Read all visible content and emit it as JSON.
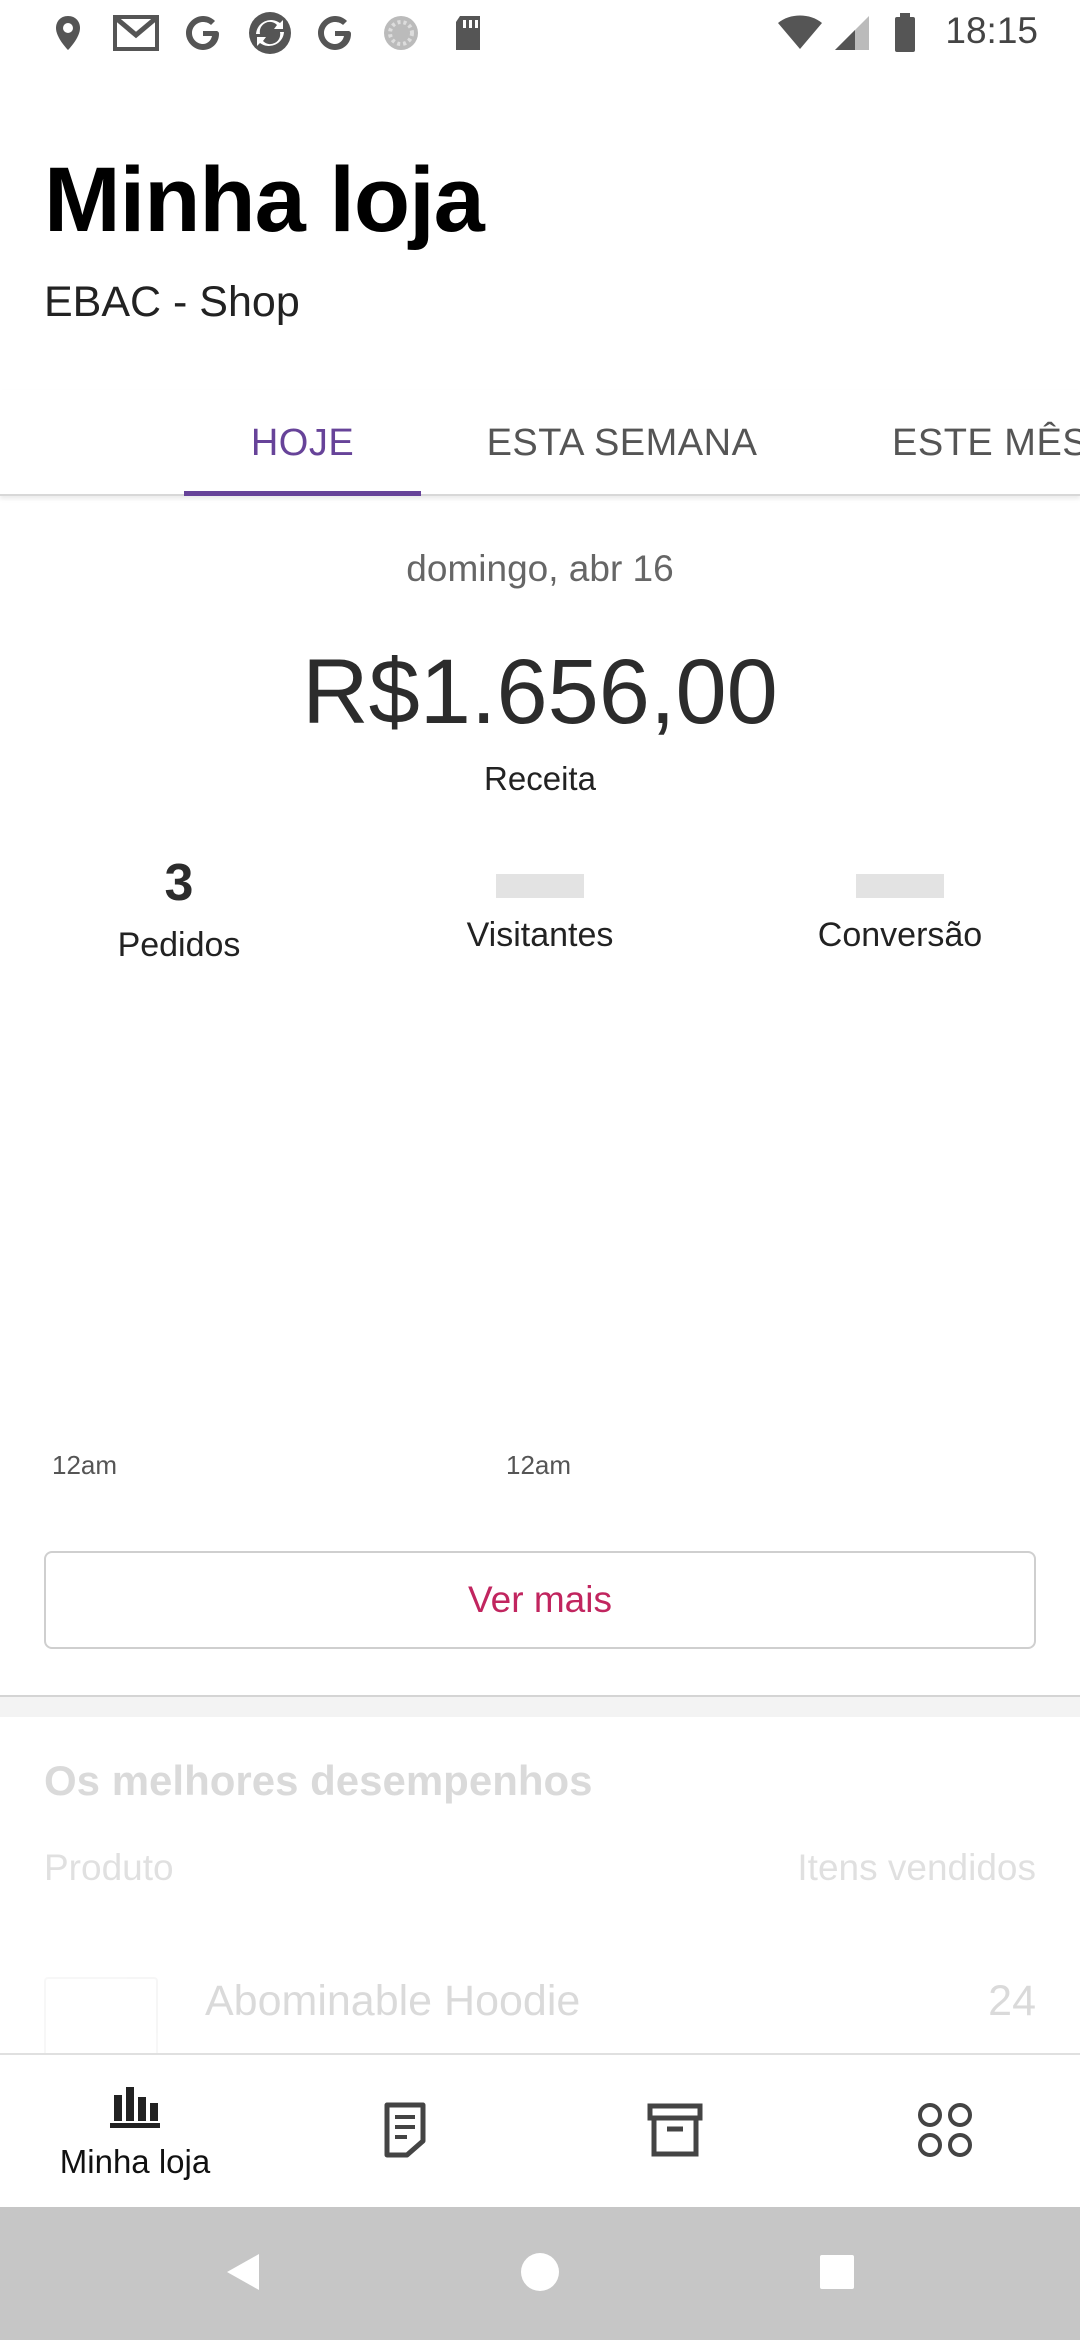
{
  "status_bar": {
    "time": "18:15",
    "left_icons": [
      "location-icon",
      "gmail-icon",
      "google-icon",
      "sync-app-icon",
      "google-icon",
      "loading-icon",
      "sd-card-icon"
    ],
    "right_icons": [
      "wifi-icon",
      "signal-icon",
      "battery-icon"
    ]
  },
  "header": {
    "title": "Minha loja",
    "store_name": "EBAC - Shop"
  },
  "tabs": [
    {
      "label": "HOJE",
      "active": true
    },
    {
      "label": "ESTA SEMANA",
      "active": false
    },
    {
      "label": "ESTE MÊS",
      "active": false
    }
  ],
  "stats": {
    "date": "domingo, abr 16",
    "revenue": "R$1.656,00",
    "revenue_label": "Receita",
    "metrics": [
      {
        "label": "Pedidos",
        "value": "3"
      },
      {
        "label": "Visitantes",
        "value": ""
      },
      {
        "label": "Conversão",
        "value": ""
      }
    ],
    "chart_labels": [
      "12am",
      "12am"
    ],
    "more_button": "Ver mais"
  },
  "top_performers": {
    "title": "Os melhores desempenhos",
    "col_product": "Produto",
    "col_items": "Itens vendidos",
    "rows": [
      {
        "name": "Abominable Hoodie",
        "count": "24"
      }
    ]
  },
  "bottom_nav": [
    {
      "label": "Minha loja",
      "icon": "bar-chart-icon",
      "active": true
    },
    {
      "label": "",
      "icon": "orders-icon",
      "active": false
    },
    {
      "label": "",
      "icon": "products-icon",
      "active": false
    },
    {
      "label": "",
      "icon": "more-apps-icon",
      "active": false
    }
  ],
  "colors": {
    "accent": "#674399",
    "button_text": "#c1255f"
  }
}
